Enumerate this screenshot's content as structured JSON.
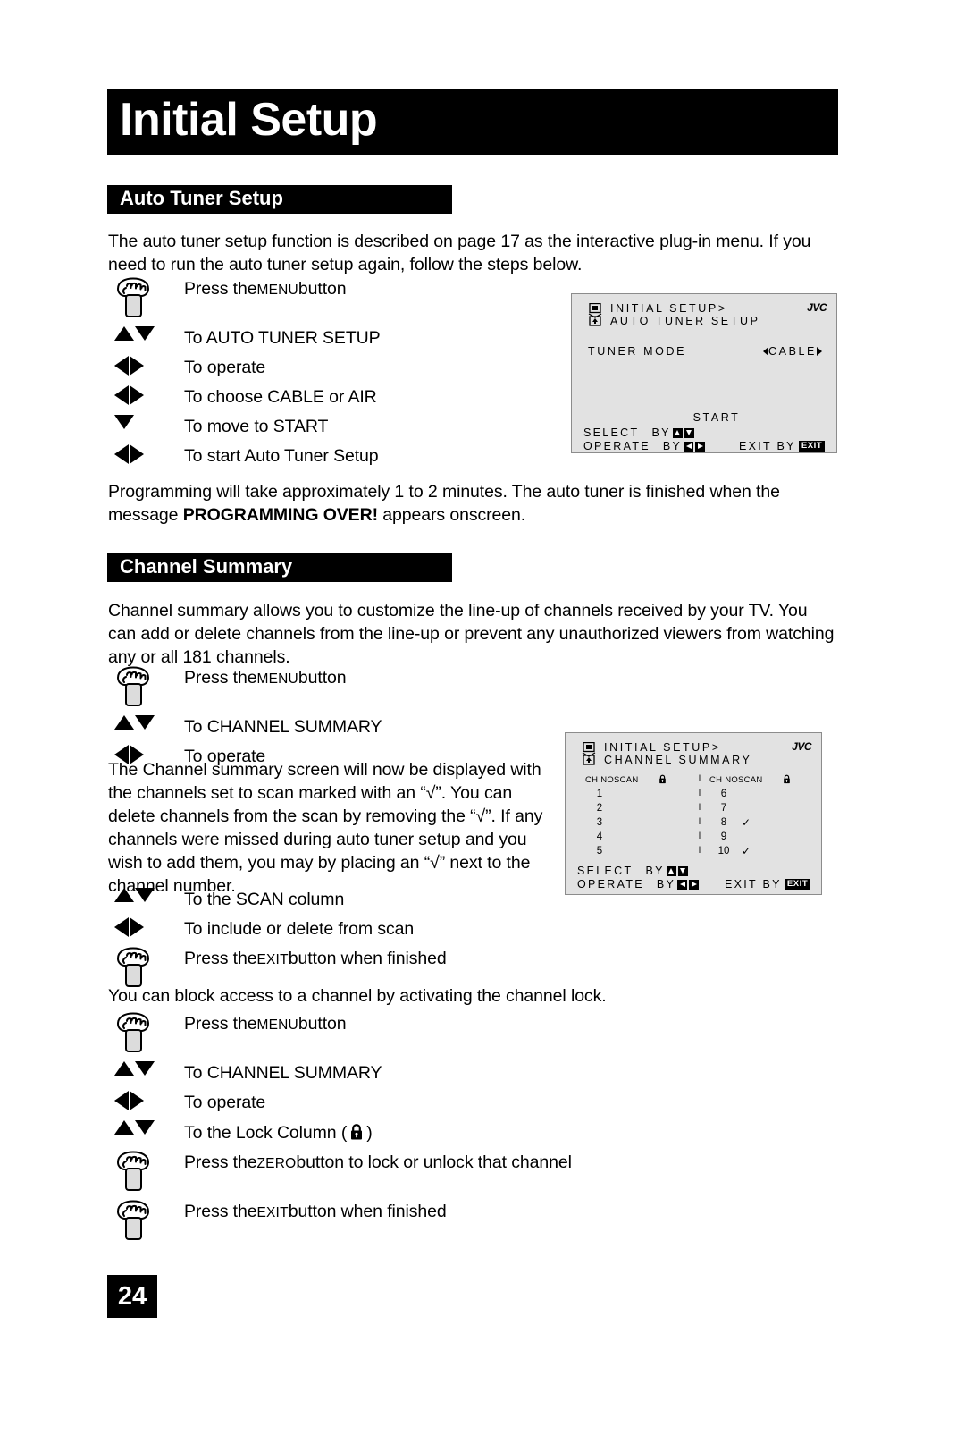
{
  "page": {
    "title": "Initial Setup",
    "number": "24"
  },
  "sections": {
    "auto_tuner": {
      "heading": "Auto Tuner Setup",
      "intro": "The auto tuner setup function is described on page 17 as the interactive plug-in menu.  If you need to run the auto tuner setup again, follow the steps below.",
      "steps": [
        {
          "icon": "hand-press-icon",
          "prefix": "Press the ",
          "smallcaps": "MENU",
          "suffix": " button"
        },
        {
          "icon": "up-down-arrows-icon",
          "prefix": "To AUTO TUNER SETUP",
          "smallcaps": "",
          "suffix": ""
        },
        {
          "icon": "left-right-arrows-icon",
          "prefix": "To operate",
          "smallcaps": "",
          "suffix": ""
        },
        {
          "icon": "left-right-arrows-icon",
          "prefix": "To choose CABLE or AIR",
          "smallcaps": "",
          "suffix": ""
        },
        {
          "icon": "down-arrow-icon",
          "prefix": "To move to START",
          "smallcaps": "",
          "suffix": ""
        },
        {
          "icon": "left-right-arrows-icon",
          "prefix": "To start Auto Tuner Setup",
          "smallcaps": "",
          "suffix": ""
        }
      ],
      "note_pre": "Programming will take approximately 1 to 2 minutes.  The auto tuner is finished when the message ",
      "note_bold": "PROGRAMMING OVER!",
      "note_post": " appears onscreen."
    },
    "channel_summary": {
      "heading": "Channel Summary",
      "intro": "Channel summary allows you to customize the line-up of channels received by your TV. You can add or delete channels from the line-up or prevent any unauthorized viewers from watching any or all 181 channels.",
      "steps_a": [
        {
          "icon": "hand-press-icon",
          "prefix": "Press the ",
          "smallcaps": "MENU",
          "suffix": " button"
        },
        {
          "icon": "up-down-arrows-icon",
          "prefix": "To CHANNEL SUMMARY",
          "smallcaps": "",
          "suffix": ""
        },
        {
          "icon": "left-right-arrows-icon",
          "prefix": "To operate",
          "smallcaps": "",
          "suffix": ""
        }
      ],
      "body": "The Channel summary screen will now be displayed with the channels set to scan marked with an “√”. You can delete channels from the scan by removing the “√”. If any channels were missed during auto tuner setup and you wish to add them, you may by placing an “√” next to the channel number.",
      "steps_b": [
        {
          "icon": "up-down-arrows-icon",
          "prefix": "To the SCAN column",
          "smallcaps": "",
          "suffix": ""
        },
        {
          "icon": "left-right-arrows-icon",
          "prefix": "To include or delete from scan",
          "smallcaps": "",
          "suffix": ""
        },
        {
          "icon": "hand-press-icon",
          "prefix": "Press the ",
          "smallcaps": "EXIT",
          "suffix": " button when finished"
        }
      ],
      "lock_note": "You can block access to a channel by activating the channel lock.",
      "steps_c": [
        {
          "icon": "hand-press-icon",
          "prefix": "Press the ",
          "smallcaps": "MENU",
          "suffix": " button"
        },
        {
          "icon": "up-down-arrows-icon",
          "prefix": "To CHANNEL SUMMARY",
          "smallcaps": "",
          "suffix": ""
        },
        {
          "icon": "left-right-arrows-icon",
          "prefix": "To operate",
          "smallcaps": "",
          "suffix": ""
        },
        {
          "icon": "up-down-arrows-icon",
          "prefix": "To the Lock Column ( ",
          "smallcaps": "",
          "suffix": " )",
          "has_lock": true
        },
        {
          "icon": "hand-press-icon",
          "prefix": "Press the ",
          "smallcaps": "ZERO",
          "suffix": " button to lock or unlock that channel"
        },
        {
          "icon": "hand-press-icon",
          "prefix": "Press the ",
          "smallcaps": "EXIT",
          "suffix": " button when finished"
        }
      ]
    }
  },
  "osd_auto_tuner": {
    "brand": "JVC",
    "menu_path": "INITIAL SETUP>",
    "menu_name": "AUTO TUNER SETUP",
    "tuner_mode_label": "TUNER MODE",
    "tuner_mode_value": "CABLE",
    "start_label": "START",
    "select_label": "SELECT",
    "select_by": "BY",
    "operate_label": "OPERATE",
    "operate_by": "BY",
    "exit_label": "EXIT BY",
    "exit_badge": "EXIT"
  },
  "osd_channel_summary": {
    "brand": "JVC",
    "menu_path": "INITIAL SETUP>",
    "menu_name": "CHANNEL SUMMARY",
    "left_header": {
      "ch": "CH NO.",
      "scan": "SCAN",
      "lock": "lock-icon"
    },
    "right_header": {
      "ch": "CH NO",
      "scan": "SCAN",
      "lock": "lock-icon"
    },
    "left_rows": [
      {
        "ch": "1",
        "scan": "",
        "lock": ""
      },
      {
        "ch": "2",
        "scan": "",
        "lock": ""
      },
      {
        "ch": "3",
        "scan": "",
        "lock": ""
      },
      {
        "ch": "4",
        "scan": "",
        "lock": ""
      },
      {
        "ch": "5",
        "scan": "",
        "lock": ""
      }
    ],
    "right_rows": [
      {
        "ch": "6",
        "scan": "",
        "lock": ""
      },
      {
        "ch": "7",
        "scan": "",
        "lock": ""
      },
      {
        "ch": "8",
        "scan": "✓",
        "lock": ""
      },
      {
        "ch": "9",
        "scan": "",
        "lock": ""
      },
      {
        "ch": "10",
        "scan": "✓",
        "lock": ""
      }
    ],
    "select_label": "SELECT",
    "select_by": "BY",
    "operate_label": "OPERATE",
    "operate_by": "BY",
    "exit_label": "EXIT BY",
    "exit_badge": "EXIT"
  }
}
